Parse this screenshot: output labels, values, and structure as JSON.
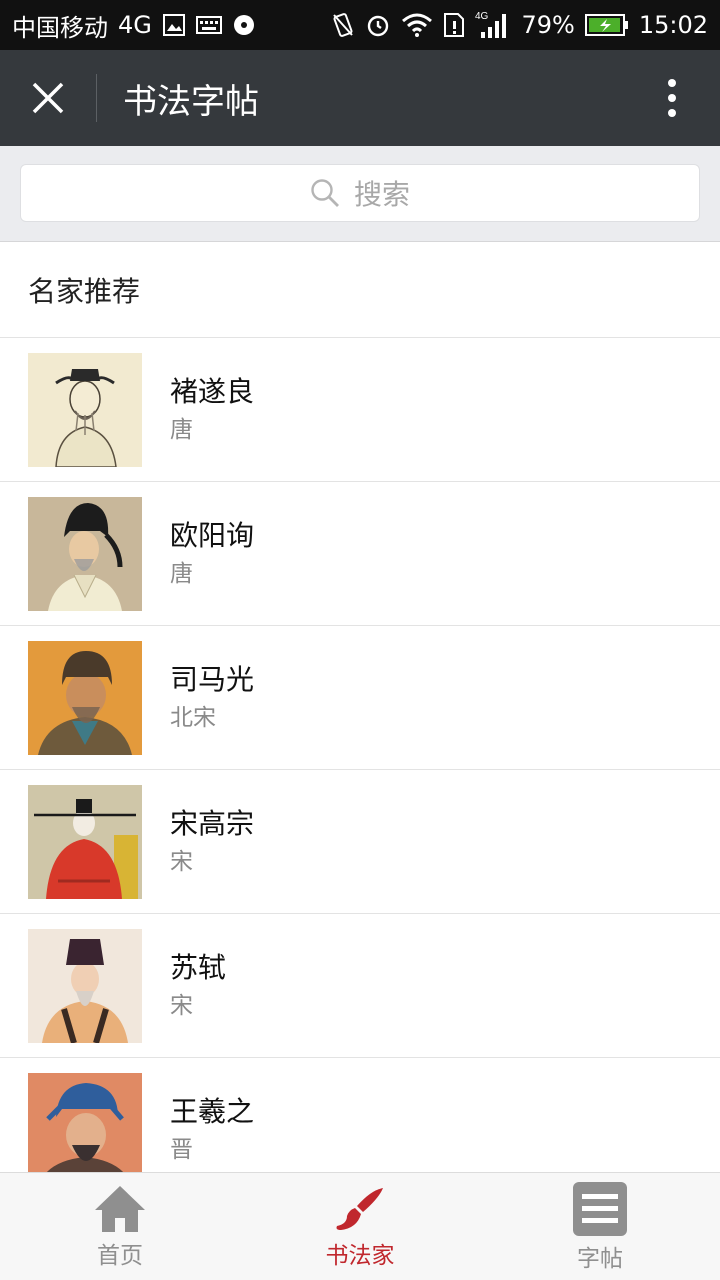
{
  "status_bar": {
    "carrier": "中国移动",
    "network": "4G",
    "signal_network": "4G",
    "battery": "79%",
    "time": "15:02"
  },
  "title_bar": {
    "title": "书法字帖",
    "close_icon": "close-icon",
    "more_icon": "more-vertical-icon"
  },
  "search": {
    "placeholder": "搜索"
  },
  "section": {
    "title": "名家推荐"
  },
  "calligraphers": [
    {
      "name": "褚遂良",
      "dynasty": "唐"
    },
    {
      "name": "欧阳询",
      "dynasty": "唐"
    },
    {
      "name": "司马光",
      "dynasty": "北宋"
    },
    {
      "name": "宋高宗",
      "dynasty": "宋"
    },
    {
      "name": "苏轼",
      "dynasty": "宋"
    },
    {
      "name": "王羲之",
      "dynasty": "晋"
    }
  ],
  "tab_bar": {
    "tabs": [
      {
        "label": "首页",
        "icon": "home-icon"
      },
      {
        "label": "书法家",
        "icon": "brush-icon"
      },
      {
        "label": "字帖",
        "icon": "list-icon"
      }
    ],
    "active_color": "#c0272d",
    "inactive_color": "#8f8f8f"
  }
}
